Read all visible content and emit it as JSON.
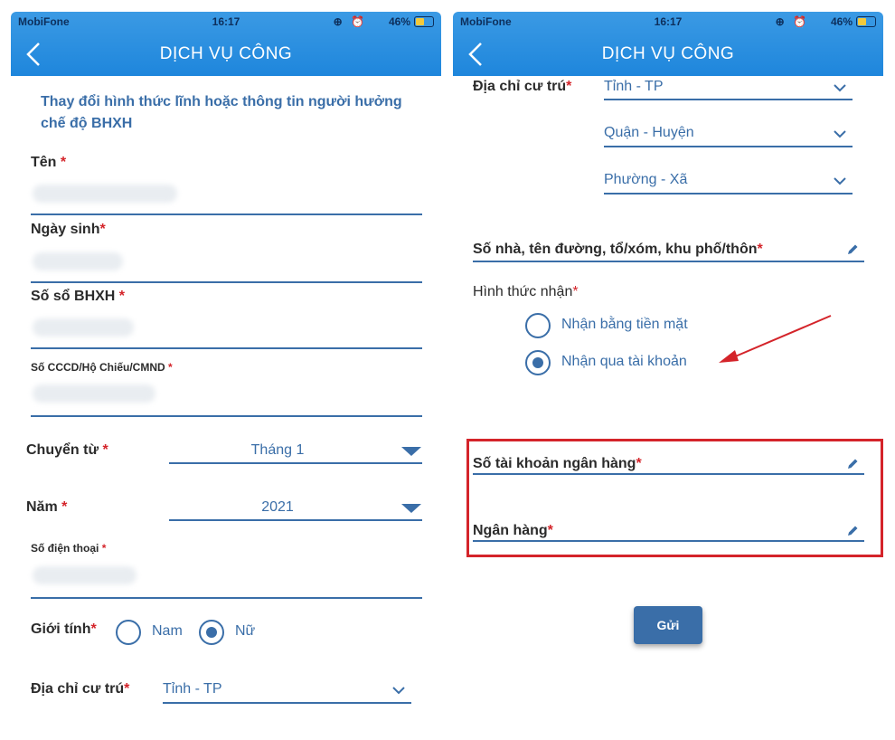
{
  "status_bar": {
    "carrier": "MobiFone",
    "time": "16:17",
    "battery": "46%"
  },
  "header": {
    "title": "DỊCH VỤ CÔNG"
  },
  "left": {
    "form_heading": "Thay đổi hình thức lĩnh hoặc thông tin người hưởng chế độ BHXH",
    "name_label": "Tên",
    "dob_label": "Ngày sinh",
    "bhxh_label": "Số sổ BHXH",
    "id_label": "Số CCCD/Hộ Chiếu/CMND",
    "move_from_label": "Chuyển từ",
    "move_from_value": "Tháng 1",
    "year_label": "Năm",
    "year_value": "2021",
    "phone_label": "Số điện thoại",
    "gender_label": "Giới tính",
    "gender_male": "Nam",
    "gender_female": "Nữ",
    "address_label": "Địa chỉ cư trú",
    "province_value": "Tỉnh - TP"
  },
  "right": {
    "address_label": "Địa chỉ cư trú",
    "province_value": "Tỉnh - TP",
    "district_value": "Quận - Huyện",
    "ward_value": "Phường - Xã",
    "street_label": "Số nhà, tên đường, tổ/xóm, khu phố/thôn",
    "receive_method_label": "Hình thức nhận",
    "option_cash": "Nhận bằng tiền mặt",
    "option_account": "Nhận qua tài khoản",
    "bank_account_label": "Số tài khoản ngân hàng",
    "bank_label": "Ngân hàng",
    "submit_label": "Gửi"
  },
  "required_mark": "*",
  "colors": {
    "header": "#1e86dc",
    "accent": "#3a6ea8",
    "highlight": "#d4242a"
  },
  "icons": [
    "back-chevron-icon",
    "dropdown-triangle-icon",
    "chevron-down-icon",
    "pencil-icon",
    "red-arrow-annotation"
  ]
}
